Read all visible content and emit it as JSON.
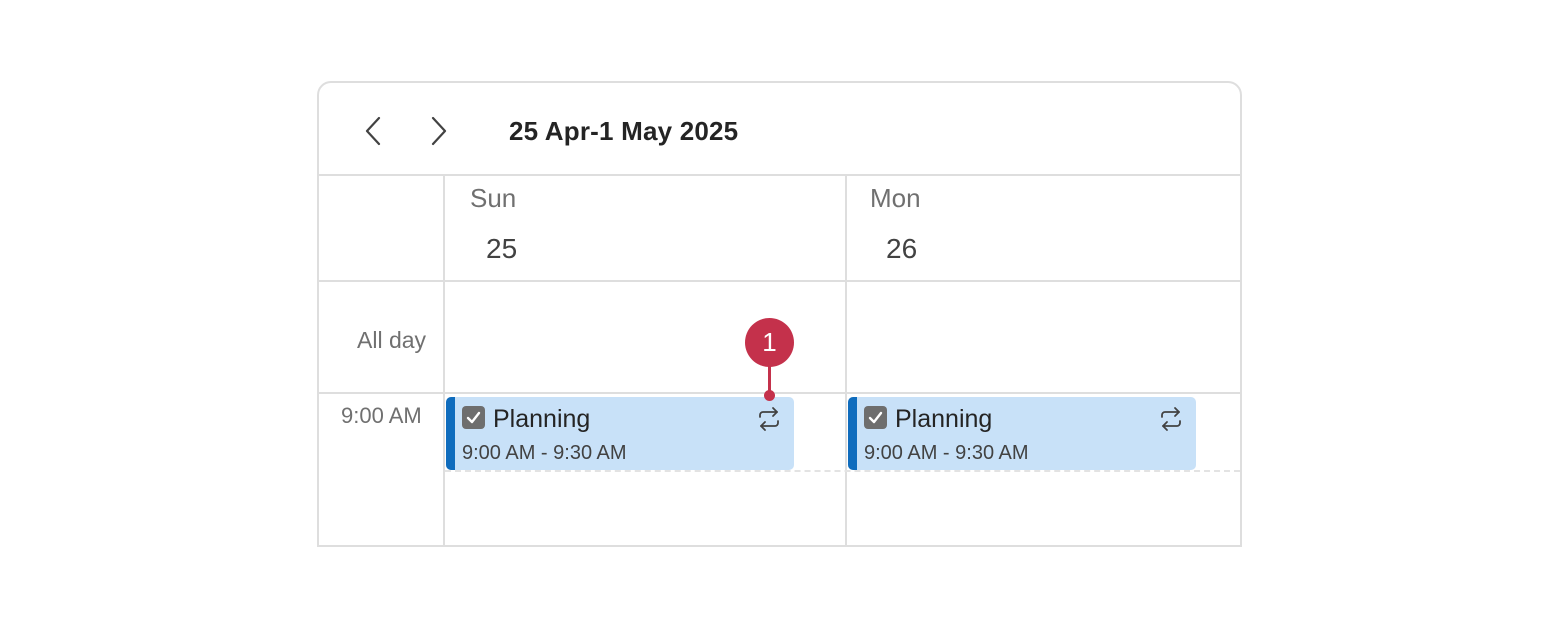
{
  "header": {
    "range_title": "25 Apr-1 May 2025",
    "prev_icon": "chevron-left-icon",
    "next_icon": "chevron-right-icon"
  },
  "days": [
    {
      "name": "Sun",
      "number": "25"
    },
    {
      "name": "Mon",
      "number": "26"
    }
  ],
  "rows": {
    "allday_label": "All day",
    "time_label": "9:00 AM"
  },
  "events": [
    {
      "title": "Planning",
      "time": "9:00 AM - 9:30 AM",
      "icon": "repeat-icon",
      "checkbox_icon": "checked-box-icon"
    },
    {
      "title": "Planning",
      "time": "9:00 AM - 9:30 AM",
      "icon": "repeat-icon",
      "checkbox_icon": "checked-box-icon"
    }
  ],
  "callout": {
    "label": "1"
  },
  "colors": {
    "event_bg": "#c8e1f8",
    "event_accent": "#0f6cbd",
    "callout": "#c4314b",
    "grid": "#dedede"
  }
}
